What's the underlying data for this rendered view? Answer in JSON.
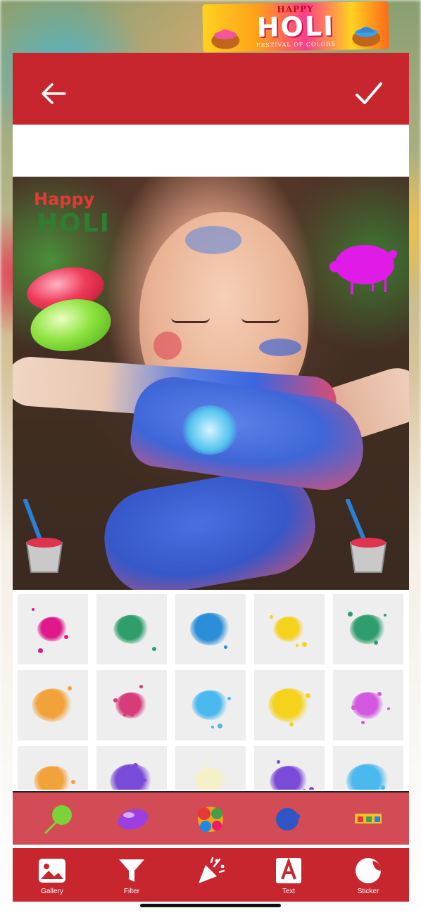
{
  "banner": {
    "happy": "HAPPY",
    "holi": "HOLI",
    "subtitle": "FESTIVAL OF COLORS"
  },
  "canvas_sticker": {
    "happy": "Happy",
    "holi": "HOLI"
  },
  "toolbar": {
    "gallery_label": "Gallery",
    "filter_label": "Filter",
    "effect_label": "",
    "text_label": "Text",
    "sticker_label": "Sticker"
  },
  "colors": {
    "primary_red": "#c8262f",
    "category_bar": "#d24b55",
    "grid_cell": "#eeeeee"
  },
  "icons": {
    "back": "arrow-left-icon",
    "done": "checkmark-icon",
    "gallery": "image-icon",
    "filter": "funnel-icon",
    "effect": "party-popper-icon",
    "text": "text-a-icon",
    "sticker": "sticker-icon"
  },
  "sticker_grid": {
    "splashes": [
      "magenta",
      "green",
      "blue",
      "yellow",
      "teal-green",
      "orange",
      "pink",
      "cyan",
      "yellow",
      "violet",
      "orange",
      "purple",
      "cream",
      "purple",
      "cyan"
    ]
  },
  "categories": [
    "lollipop",
    "balloon",
    "color-hands",
    "blue-powder",
    "holi-text"
  ]
}
